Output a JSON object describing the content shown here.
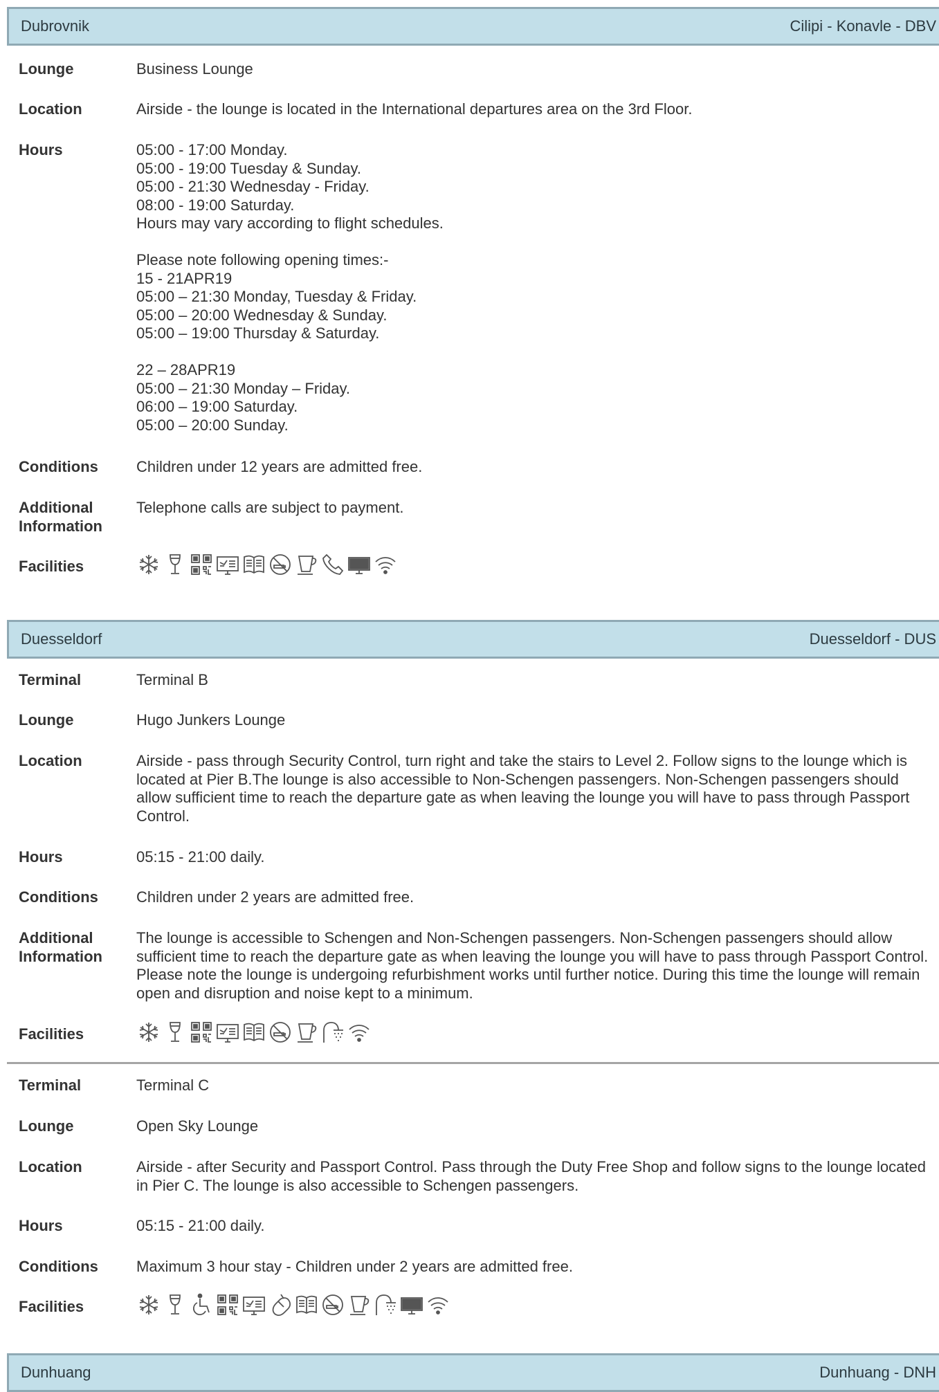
{
  "cities": [
    {
      "name": "Dubrovnik",
      "airport": "Cilipi - Konavle - DBV",
      "lounges": [
        {
          "fields": [
            {
              "label": "Lounge",
              "value": "Business Lounge"
            },
            {
              "label": "Location",
              "value": "Airside - the lounge is located in the International departures area on the 3rd Floor."
            },
            {
              "label": "Hours",
              "value": "05:00 - 17:00 Monday.\n05:00 - 19:00 Tuesday & Sunday.\n05:00 - 21:30 Wednesday - Friday.\n08:00 - 19:00 Saturday.\nHours may vary according to flight schedules.\n\nPlease note following opening times:-\n15 - 21APR19\n05:00 – 21:30 Monday, Tuesday & Friday.\n05:00 – 20:00 Wednesday & Sunday.\n05:00 – 19:00 Thursday & Saturday.\n\n22 – 28APR19\n05:00 – 21:30 Monday – Friday.\n06:00 – 19:00 Saturday.\n05:00 – 20:00 Sunday."
            },
            {
              "label": "Conditions",
              "value": "Children under 12 years are admitted free."
            },
            {
              "label": "Additional\nInformation",
              "value": "Telephone calls are subject to payment."
            }
          ],
          "facilities_label": "Facilities",
          "facilities": [
            "air-conditioning-icon",
            "wine-glass-icon",
            "qr-code-icon",
            "flight-info-icon",
            "newspaper-icon",
            "no-smoking-icon",
            "coffee-cup-icon",
            "telephone-icon",
            "computer-icon",
            "wifi-icon"
          ]
        }
      ]
    },
    {
      "name": "Duesseldorf",
      "airport": "Duesseldorf - DUS",
      "lounges": [
        {
          "fields": [
            {
              "label": "Terminal",
              "value": "Terminal B"
            },
            {
              "label": "Lounge",
              "value": "Hugo Junkers Lounge"
            },
            {
              "label": "Location",
              "value": "Airside - pass through Security Control, turn right and take the stairs to Level 2. Follow signs to the lounge which is located at Pier B.The lounge is also accessible to Non-Schengen passengers. Non-Schengen passengers should allow sufficient time to reach the departure gate as when leaving the lounge you will have to pass through Passport Control."
            },
            {
              "label": "Hours",
              "value": "05:15 - 21:00 daily."
            },
            {
              "label": "Conditions",
              "value": "Children under 2 years are admitted free."
            },
            {
              "label": "Additional\nInformation",
              "value": "The lounge is accessible to Schengen and Non-Schengen passengers. Non-Schengen passengers should allow sufficient time to reach the departure gate as when leaving the lounge you will have to pass through Passport Control. Please note the lounge is undergoing refurbishment works until further notice. During this time the lounge will remain open and disruption and noise kept to a minimum."
            }
          ],
          "facilities_label": "Facilities",
          "facilities": [
            "air-conditioning-icon",
            "wine-glass-icon",
            "qr-code-icon",
            "flight-info-icon",
            "newspaper-icon",
            "no-smoking-icon",
            "coffee-cup-icon",
            "shower-icon",
            "wifi-icon"
          ]
        },
        {
          "fields": [
            {
              "label": "Terminal",
              "value": "Terminal C"
            },
            {
              "label": "Lounge",
              "value": "Open Sky Lounge"
            },
            {
              "label": "Location",
              "value": "Airside - after Security and Passport Control. Pass through the Duty Free Shop and follow signs to the lounge located in Pier C. The lounge is also accessible to Schengen passengers."
            },
            {
              "label": "Hours",
              "value": "05:15 - 21:00 daily."
            },
            {
              "label": "Conditions",
              "value": "Maximum 3 hour stay - Children under 2 years are admitted free."
            }
          ],
          "facilities_label": "Facilities",
          "facilities": [
            "air-conditioning-icon",
            "wine-glass-icon",
            "wheelchair-icon",
            "qr-code-icon",
            "flight-info-icon",
            "mouse-icon",
            "newspaper-icon",
            "no-smoking-icon",
            "coffee-cup-icon",
            "shower-icon",
            "computer-icon",
            "wifi-icon"
          ]
        }
      ]
    },
    {
      "name": "Dunhuang",
      "airport": "Dunhuang - DNH",
      "lounges": []
    }
  ]
}
